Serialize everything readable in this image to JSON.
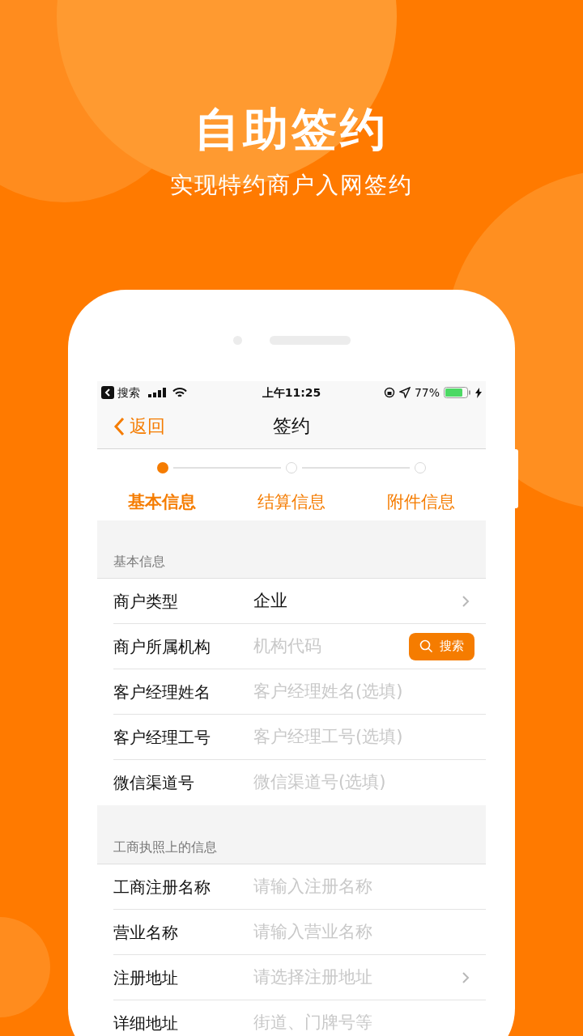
{
  "headline": {
    "title": "自助签约",
    "subtitle": "实现特约商户入网签约"
  },
  "status_bar": {
    "back_app": "搜索",
    "time": "上午11:25",
    "battery": "77%"
  },
  "nav": {
    "back": "返回",
    "title": "签约"
  },
  "steps": [
    {
      "label": "基本信息",
      "selected": true
    },
    {
      "label": "结算信息",
      "selected": false
    },
    {
      "label": "附件信息",
      "selected": false
    }
  ],
  "sections": [
    {
      "header": "基本信息",
      "rows": [
        {
          "kind": "select",
          "label": "商户类型",
          "value": "企业"
        },
        {
          "kind": "search",
          "label": "商户所属机构",
          "placeholder": "机构代码",
          "button": "搜索"
        },
        {
          "kind": "input",
          "label": "客户经理姓名",
          "placeholder": "客户经理姓名(选填)"
        },
        {
          "kind": "input",
          "label": "客户经理工号",
          "placeholder": "客户经理工号(选填)"
        },
        {
          "kind": "input",
          "label": "微信渠道号",
          "placeholder": "微信渠道号(选填)"
        }
      ]
    },
    {
      "header": "工商执照上的信息",
      "rows": [
        {
          "kind": "input",
          "label": "工商注册名称",
          "placeholder": "请输入注册名称"
        },
        {
          "kind": "input",
          "label": "营业名称",
          "placeholder": "请输入营业名称"
        },
        {
          "kind": "select",
          "label": "注册地址",
          "placeholder": "请选择注册地址"
        },
        {
          "kind": "input",
          "label": "详细地址",
          "placeholder": "街道、门牌号等"
        }
      ]
    }
  ]
}
